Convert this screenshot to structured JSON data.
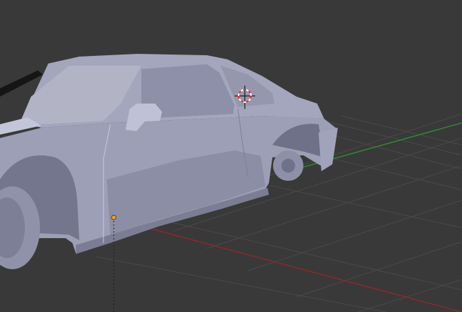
{
  "viewport": {
    "background": "#393939",
    "grid_color": "#4a4a4a",
    "x_axis_color": "#8a2a2a",
    "y_axis_color": "#2f8a2f",
    "model_color": "#9c9fb6",
    "model_shadow_color": "#6e7188",
    "model_highlight_color": "#c3c6d9",
    "glass_color": "#b2b4c6",
    "origin_color": "#f0a030",
    "cursor_ring_color_a": "#e02020",
    "cursor_ring_color_b": "#ffffff",
    "cursor_crosshair_color": "#000000"
  },
  "icons": {
    "cursor": "3d-cursor-icon",
    "origin": "object-origin-icon"
  }
}
